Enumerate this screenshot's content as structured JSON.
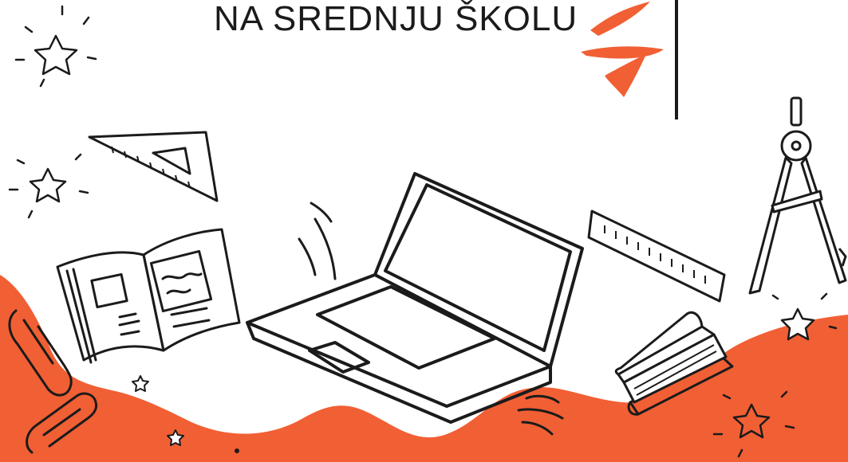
{
  "header": {
    "title": "NA SREDNJU ŠKOLU"
  },
  "colors": {
    "accent": "#f15f34",
    "ink": "#1b1b1b",
    "background": "#ffffff"
  },
  "illustrations": [
    "laptop-icon",
    "open-book-icon",
    "set-square-icon",
    "ruler-icon",
    "compass-icon",
    "book-stack-icon",
    "paperclip-icon",
    "sparkle-star-icon",
    "splash-accent-icon"
  ]
}
